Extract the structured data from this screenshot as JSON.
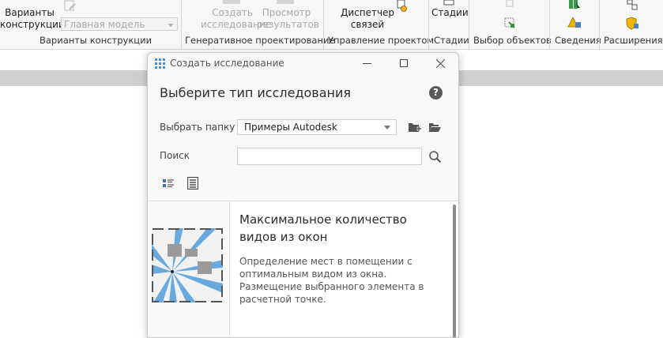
{
  "ribbon": {
    "variants_button_line1": "Варианты",
    "variants_button_line2": "конструкции",
    "main_model_combo": "Главная модель",
    "create_study_line1": "Создать",
    "create_study_line2": "исследование",
    "view_results_line1": "Просмотр",
    "view_results_line2": "результатов",
    "dispatcher_line1": "Диспетчер",
    "dispatcher_line2": "связей",
    "stages_button": "Стадии",
    "groups": {
      "variants": "Варианты конструкции",
      "generative": "Генеративное проектирование",
      "management": "Управление проектом",
      "stages": "Стадии",
      "selection": "Выбор объектов",
      "info": "Сведения",
      "extensions": "Расширения"
    }
  },
  "dialog": {
    "title": "Создать исследование",
    "heading": "Выберите тип исследования",
    "folder_label": "Выбрать папку",
    "folder_value": "Примеры Autodesk",
    "search_label": "Поиск",
    "search_value": "",
    "help_glyph": "?",
    "items": [
      {
        "title": "Максимальное количество видов из окон",
        "description": "Определение мест в помещении с оптимальным видом из окна. Размещение выбранного элемента в расчетной точке."
      }
    ]
  },
  "colors": {
    "ribbon_bg": "#f7f7f7",
    "dialog_bg": "#f8f8f8",
    "accent_blue": "#5aa3de",
    "gray_band": "#cfcfcf"
  },
  "icons": [
    "grid-app-icon",
    "minimize-icon",
    "maximize-icon",
    "close-icon",
    "help-icon",
    "new-folder-icon",
    "open-folder-icon",
    "search-icon",
    "list-view-icon",
    "detail-view-icon"
  ]
}
